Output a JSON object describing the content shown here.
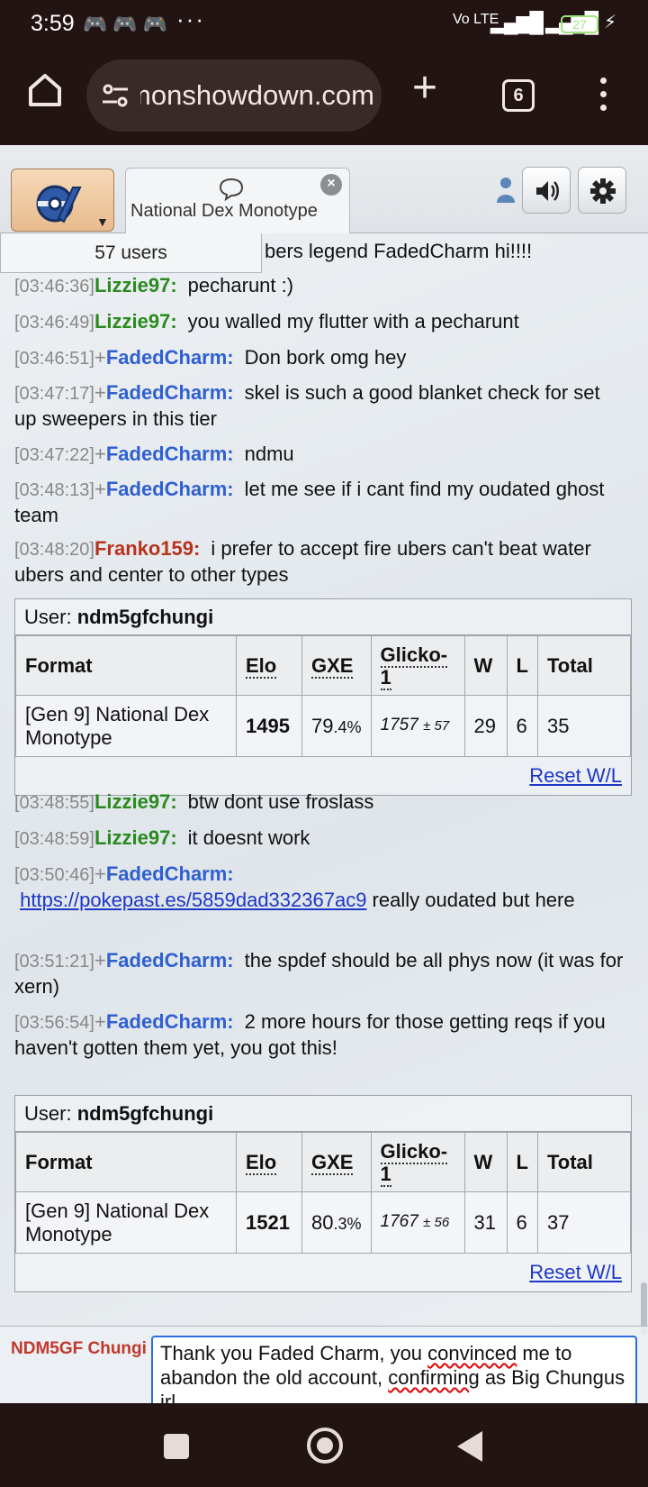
{
  "status_bar": {
    "time": "3:59",
    "notifications": "🎮🎮🎮",
    "more": "···",
    "network": "Vo LTE",
    "battery": "27"
  },
  "browser": {
    "url": "pokemonshowdown.com",
    "tab_count": "6"
  },
  "ps_header": {
    "room_tab_label": "National Dex Monotype",
    "users_count": "57 users"
  },
  "chat": {
    "partial_line": "bers legend FadedCharm hi!!!!",
    "messages": [
      {
        "time": "[03:46:36]",
        "rank": "",
        "user": "Lizzie97:",
        "text": "pecharunt :)"
      },
      {
        "time": "[03:46:49]",
        "rank": "",
        "user": "Lizzie97:",
        "text": "you walled my flutter with a pecharunt"
      },
      {
        "time": "[03:46:51]",
        "rank": "+",
        "user": "FadedCharm:",
        "text": "Don bork omg hey"
      },
      {
        "time": "[03:47:17]",
        "rank": "+",
        "user": "FadedCharm:",
        "text": "skel is such a good blanket check for set up sweepers in this tier"
      },
      {
        "time": "[03:47:22]",
        "rank": "+",
        "user": "FadedCharm:",
        "text": "ndmu"
      },
      {
        "time": "[03:48:13]",
        "rank": "+",
        "user": "FadedCharm:",
        "text": "let me see if i cant find my oudated ghost team"
      },
      {
        "time": "[03:48:20]",
        "rank": "",
        "user": "Franko159:",
        "text": "i prefer to accept fire ubers can't beat water ubers and center to other types"
      },
      {
        "time": "[03:48:55]",
        "rank": "",
        "user": "Lizzie97:",
        "text": "btw dont use froslass"
      },
      {
        "time": "[03:48:59]",
        "rank": "",
        "user": "Lizzie97:",
        "text": "it doesnt work"
      },
      {
        "time": "[03:50:46]",
        "rank": "+",
        "user": "FadedCharm:",
        "link": "https://pokepast.es/5859dad332367ac9",
        "text": " really oudated but here"
      },
      {
        "time": "[03:51:21]",
        "rank": "+",
        "user": "FadedCharm:",
        "text": "the spdef should be all phys now (it was for xern)"
      },
      {
        "time": "[03:56:54]",
        "rank": "+",
        "user": "FadedCharm:",
        "text": "2 more hours for those getting reqs if you haven't gotten them yet, you got this!"
      }
    ],
    "user_colors": {
      "Lizzie97": "#2a8a1e",
      "FadedCharm": "#2f5fd0",
      "Franko159": "#b8321e"
    }
  },
  "ranks": [
    {
      "user_label": "User:",
      "user": "ndm5gfchungi",
      "headers": [
        "Format",
        "Elo",
        "GXE",
        "Glicko-1",
        "W",
        "L",
        "Total"
      ],
      "format": "[Gen 9] National Dex Monotype",
      "elo": "1495",
      "gxe_main": "79",
      "gxe_dec": ".4%",
      "glicko": "1757",
      "glicko_dev": "± 57",
      "w": "29",
      "l": "6",
      "total": "35",
      "reset": "Reset W/L"
    },
    {
      "user_label": "User:",
      "user": "ndm5gfchungi",
      "headers": [
        "Format",
        "Elo",
        "GXE",
        "Glicko-1",
        "W",
        "L",
        "Total"
      ],
      "format": "[Gen 9] National Dex Monotype",
      "elo": "1521",
      "gxe_main": "80",
      "gxe_dec": ".3%",
      "glicko": "1767",
      "glicko_dev": "± 56",
      "w": "31",
      "l": "6",
      "total": "37",
      "reset": "Reset W/L"
    }
  ],
  "compose": {
    "my_name": "NDM5GF Chungi",
    "text_before": "Thank you Faded Charm, you ",
    "word1": "convinced",
    "text_mid": " me to abandon the old account, ",
    "word2": "confirming",
    "text_after": " as Big Chungus irl"
  }
}
